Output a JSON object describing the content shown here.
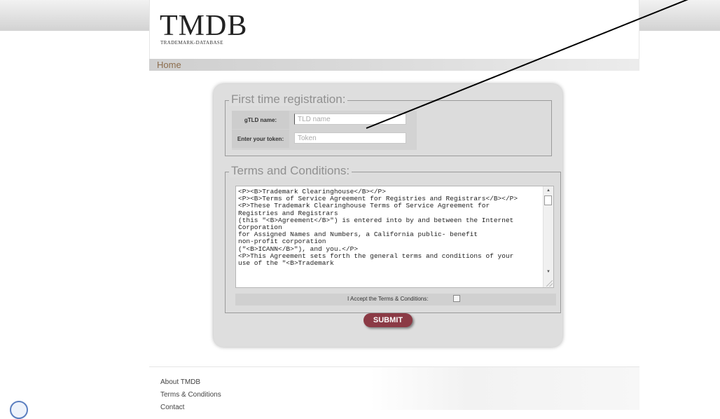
{
  "header": {
    "logo_title": "TMDB",
    "logo_subtitle": "TRADEMARK-DATABASE"
  },
  "nav": {
    "home_label": "Home"
  },
  "registration": {
    "legend": "First time registration:",
    "tld_label": "gTLD name:",
    "tld_placeholder": "TLD name",
    "token_label": "Enter your token:",
    "token_placeholder": "Token"
  },
  "terms": {
    "legend": "Terms and Conditions:",
    "text": "<P><B>Trademark Clearinghouse</B></P>\n<P><B>Terms of Service Agreement for Registries and Registrars</B></P>\n<P>These Trademark Clearinghouse Terms of Service Agreement for\nRegistries and Registrars\n(this \"<B>Agreement</B>\") is entered into by and between the Internet\nCorporation\nfor Assigned Names and Numbers, a California public- benefit\nnon-profit corporation\n(\"<B>ICANN</B>\"), and you.</P>\n<P>This Agreement sets forth the general terms and conditions of your\nuse of the \"<B>Trademark",
    "accept_label": "I Accept the Terms & Conditions:",
    "accept_checked": false
  },
  "submit_label": "SUBMIT",
  "colors": {
    "submit_bg": "#8b3a45",
    "nav_text": "#8c6d4d",
    "panel_bg": "#dedede"
  },
  "footer": {
    "links": [
      "About TMDB",
      "Terms & Conditions",
      "Contact"
    ]
  }
}
